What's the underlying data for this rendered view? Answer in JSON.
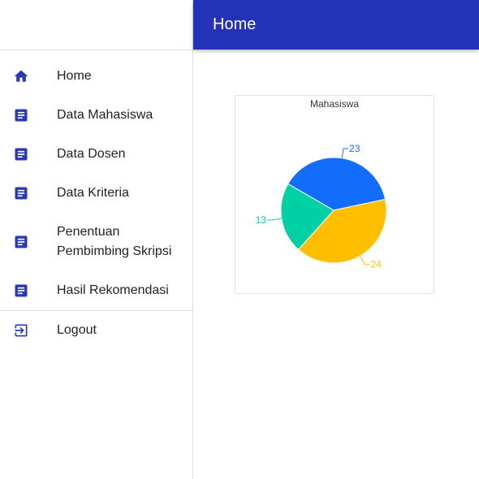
{
  "header": {
    "title": "Home"
  },
  "sidebar": {
    "items": [
      {
        "label": "Home",
        "icon": "home-icon"
      },
      {
        "label": "Data Mahasiswa",
        "icon": "document-icon"
      },
      {
        "label": "Data Dosen",
        "icon": "document-icon"
      },
      {
        "label": "Data Kriteria",
        "icon": "document-icon"
      },
      {
        "label": "Penentuan Pembimbing Skripsi",
        "icon": "document-icon"
      },
      {
        "label": "Hasil Rekomendasi",
        "icon": "document-icon"
      }
    ],
    "logout": {
      "label": "Logout",
      "icon": "logout-icon"
    }
  },
  "colors": {
    "accent": "#2431b9",
    "icon": "#2b38b5"
  },
  "chart_data": {
    "type": "pie",
    "title": "Mahasiswa",
    "slices": [
      {
        "value": 23,
        "color": "#126dfb"
      },
      {
        "value": 24,
        "color": "#ffbe00"
      },
      {
        "value": 13,
        "color": "#00d0a3"
      }
    ]
  }
}
